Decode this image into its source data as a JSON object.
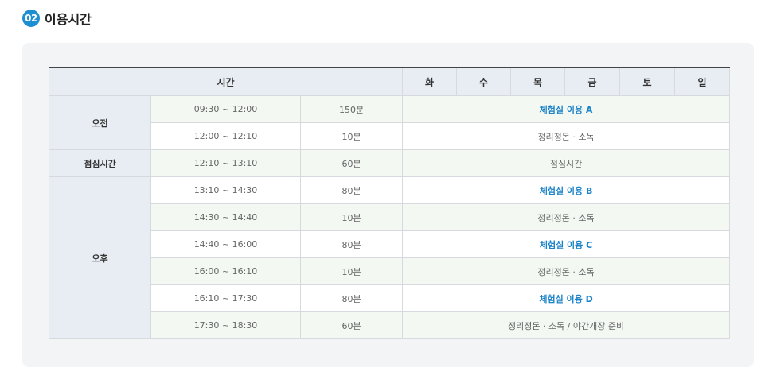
{
  "section": {
    "number": "02",
    "title": "이용시간"
  },
  "table": {
    "time_header": "시간",
    "days": [
      "화",
      "수",
      "목",
      "금",
      "토",
      "일"
    ],
    "periods": {
      "morning": "오전",
      "lunch": "점심시간",
      "afternoon": "오후"
    },
    "rows": [
      {
        "time": "09:30 ~ 12:00",
        "duration": "150분",
        "activity": "체험실 이용 A"
      },
      {
        "time": "12:00 ~ 12:10",
        "duration": "10분",
        "activity": "정리정돈 · 소독"
      },
      {
        "time": "12:10 ~ 13:10",
        "duration": "60분",
        "activity": "점심시간"
      },
      {
        "time": "13:10 ~ 14:30",
        "duration": "80분",
        "activity": "체험실 이용 B"
      },
      {
        "time": "14:30 ~ 14:40",
        "duration": "10분",
        "activity": "정리정돈 · 소독"
      },
      {
        "time": "14:40 ~ 16:00",
        "duration": "80분",
        "activity": "체험실 이용 C"
      },
      {
        "time": "16:00 ~ 16:10",
        "duration": "10분",
        "activity": "정리정돈 · 소독"
      },
      {
        "time": "16:10 ~ 17:30",
        "duration": "80분",
        "activity": "체험실 이용 D"
      },
      {
        "time": "17:30 ~ 18:30",
        "duration": "60분",
        "activity": "정리정돈 · 소독 / 야간개장 준비"
      }
    ]
  },
  "colors": {
    "accent": "#1e8fd0",
    "link_text": "#1a82c8",
    "header_bg": "#e8edf4",
    "alt_row_bg": "#f3f8f3"
  }
}
